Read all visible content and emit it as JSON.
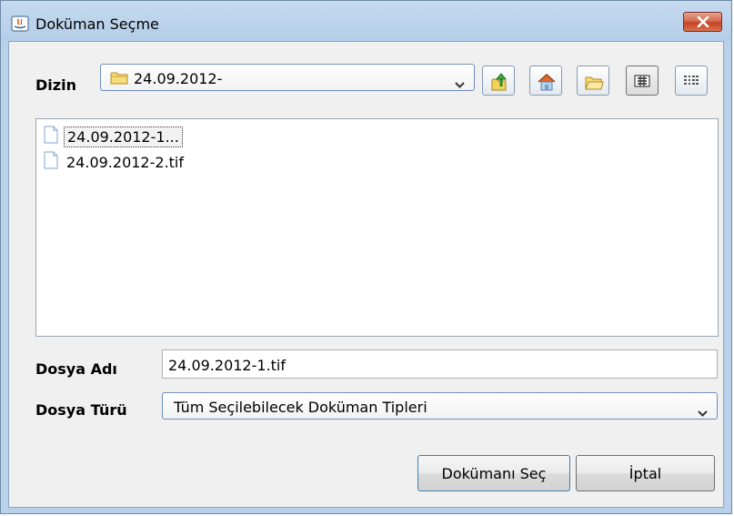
{
  "window": {
    "title": "Doküman Seçme",
    "close_label": "close"
  },
  "directory": {
    "label": "Dizin",
    "current": "24.09.2012-"
  },
  "toolbar": {
    "buttons": [
      "up-one-level-icon",
      "home-icon",
      "new-folder-icon",
      "list-view-icon",
      "details-view-icon"
    ]
  },
  "files": [
    {
      "name": "24.09.2012-1...",
      "selected": true
    },
    {
      "name": "24.09.2012-2.tif",
      "selected": false
    }
  ],
  "filename": {
    "label": "Dosya Adı",
    "value": "24.09.2012-1.tif"
  },
  "filetype": {
    "label": "Dosya Türü",
    "value": "Tüm Seçilebilecek Doküman Tipleri"
  },
  "actions": {
    "select_label": "Dokümanı Seç",
    "cancel_label": "İptal"
  },
  "colors": {
    "title_bar": "#b9d1ea",
    "close_button": "#c54325",
    "dialog_bg": "#f0f0f0"
  }
}
